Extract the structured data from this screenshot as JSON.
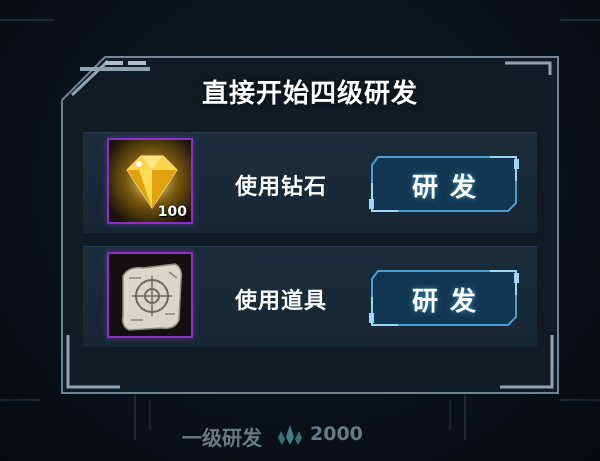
{
  "dialog": {
    "title": "直接开始四级研发",
    "options": [
      {
        "item_icon": "diamond-gem-icon",
        "quantity": "100",
        "label": "使用钻石",
        "button_label": "研发"
      },
      {
        "item_icon": "blueprint-scroll-icon",
        "quantity": "",
        "label": "使用道具",
        "button_label": "研发"
      }
    ]
  },
  "footer": {
    "text": "一级研发",
    "currency_icon": "crystal-cluster-icon",
    "value": "2000"
  },
  "colors": {
    "frame": "#6d8596",
    "panel": "#101b24",
    "row": "#1a2b39",
    "button": "#123650",
    "button_border": "#4a9fd0",
    "slot_border": "#8a2fc7"
  }
}
